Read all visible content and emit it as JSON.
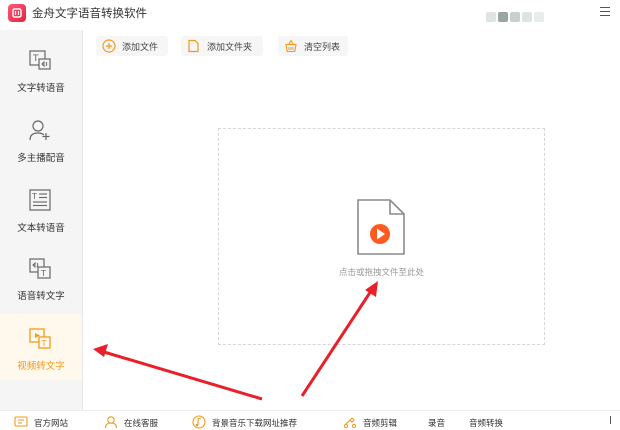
{
  "app": {
    "title": "金舟文字语音转换软件",
    "accent_color": "#f39a1b",
    "logo_color": "#e6213c",
    "logo_icon": "app-logo-icon",
    "menu_icon": "hamburger-menu-icon"
  },
  "sidebar": {
    "items": [
      {
        "label": "文字转语音",
        "icon": "text-to-speech-icon",
        "active": false
      },
      {
        "label": "多主播配音",
        "icon": "multi-speaker-icon",
        "active": false
      },
      {
        "label": "文本转语音",
        "icon": "document-to-speech-icon",
        "active": false
      },
      {
        "label": "语音转文字",
        "icon": "speech-to-text-icon",
        "active": false
      },
      {
        "label": "视频转文字",
        "icon": "video-to-text-icon",
        "active": true
      }
    ]
  },
  "toolbar": {
    "add_file": "添加文件",
    "add_folder": "添加文件夹",
    "clear_list": "清空列表"
  },
  "dropzone": {
    "hint": "点击或拖拽文件至此处",
    "icon": "video-file-icon"
  },
  "footer": {
    "items": [
      {
        "label": "官方网站",
        "icon": "website-icon"
      },
      {
        "label": "在线客服",
        "icon": "customer-service-icon"
      },
      {
        "label": "背景音乐下载网址推荐",
        "icon": "music-icon"
      },
      {
        "label": "音频剪辑",
        "icon": "audio-edit-icon"
      },
      {
        "label": "录音",
        "icon": ""
      },
      {
        "label": "音频转换",
        "icon": ""
      }
    ]
  }
}
